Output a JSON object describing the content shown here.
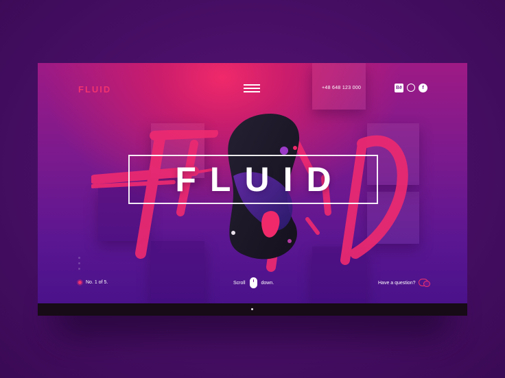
{
  "brand": {
    "logo_text": "FLUID",
    "accent_color": "#f0336f"
  },
  "header": {
    "menu_icon": "hamburger-icon",
    "phone": "+48 648 123 000",
    "social": [
      {
        "name": "behance-icon",
        "label": "Bē"
      },
      {
        "name": "dribbble-icon",
        "label": ""
      },
      {
        "name": "facebook-icon",
        "label": "f"
      }
    ]
  },
  "hero": {
    "title": "FLUID"
  },
  "footer": {
    "slide_indicator": "No. 1 of 5.",
    "scroll_before": "Scroll",
    "scroll_after": "down.",
    "question": "Have a question?"
  },
  "colors": {
    "pink": "#f0296a",
    "purple": "#7a1a8e",
    "bg": "#4a0f68"
  }
}
